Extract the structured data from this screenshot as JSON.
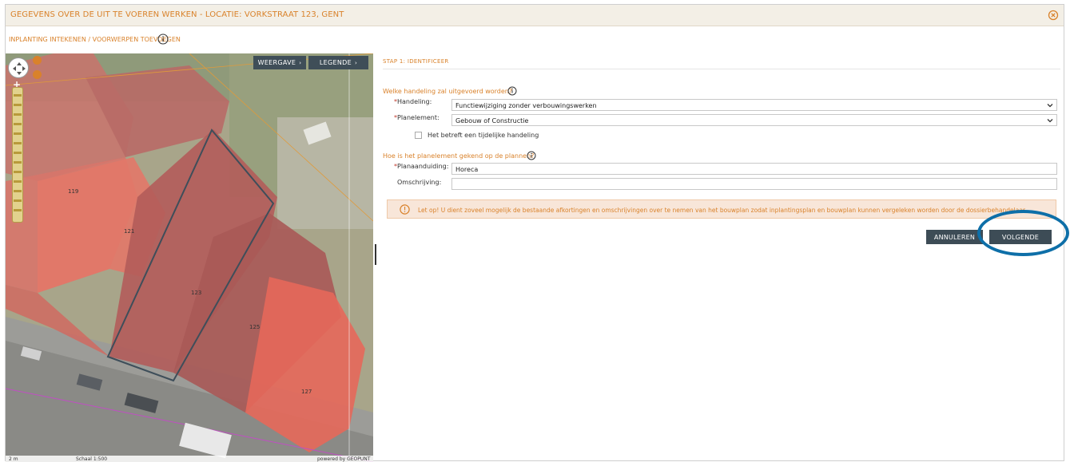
{
  "window": {
    "title": "GEGEVENS OVER DE UIT TE VOEREN WERKEN - LOCATIE: VORKSTRAAT 123, GENT",
    "subtitle": "INPLANTING INTEKENEN / VOORWERPEN TOEVOEGEN"
  },
  "map": {
    "weergave_label": "WEERGAVE",
    "legende_label": "LEGENDE",
    "parcels": [
      "119",
      "121",
      "123",
      "125",
      "127"
    ],
    "status_left": "2 m",
    "status_mid": "Schaal 1:500",
    "status_right": "powered by GEOPUNT"
  },
  "form": {
    "step_title": "STAP 1: IDENTIFICEER",
    "question1": "Welke handeling zal uitgevoerd worden?",
    "handeling_label": "Handeling:",
    "handeling_value": "Functiewijziging zonder verbouwingswerken",
    "planelement_label": "Planelement:",
    "planelement_value": "Gebouw of Constructie",
    "tijdelijk_label": "Het betreft een tijdelijke handeling",
    "question2": "Hoe is het planelement gekend op de plannen?",
    "planaanduiding_label": "Planaanduiding:",
    "planaanduiding_value": "Horeca",
    "omschrijving_label": "Omschrijving:",
    "omschrijving_value": "",
    "alert_text": "Let op! U dient zoveel mogelijk de bestaande afkortingen en omschrijvingen over te nemen van het bouwplan zodat inplantingsplan en bouwplan kunnen vergeleken worden door de dossierbehandelaar.",
    "cancel_label": "ANNULEREN",
    "next_label": "VOLGENDE"
  },
  "colors": {
    "accent": "#d9822b",
    "button": "#3d4c56",
    "highlight": "#0e6fa8"
  }
}
